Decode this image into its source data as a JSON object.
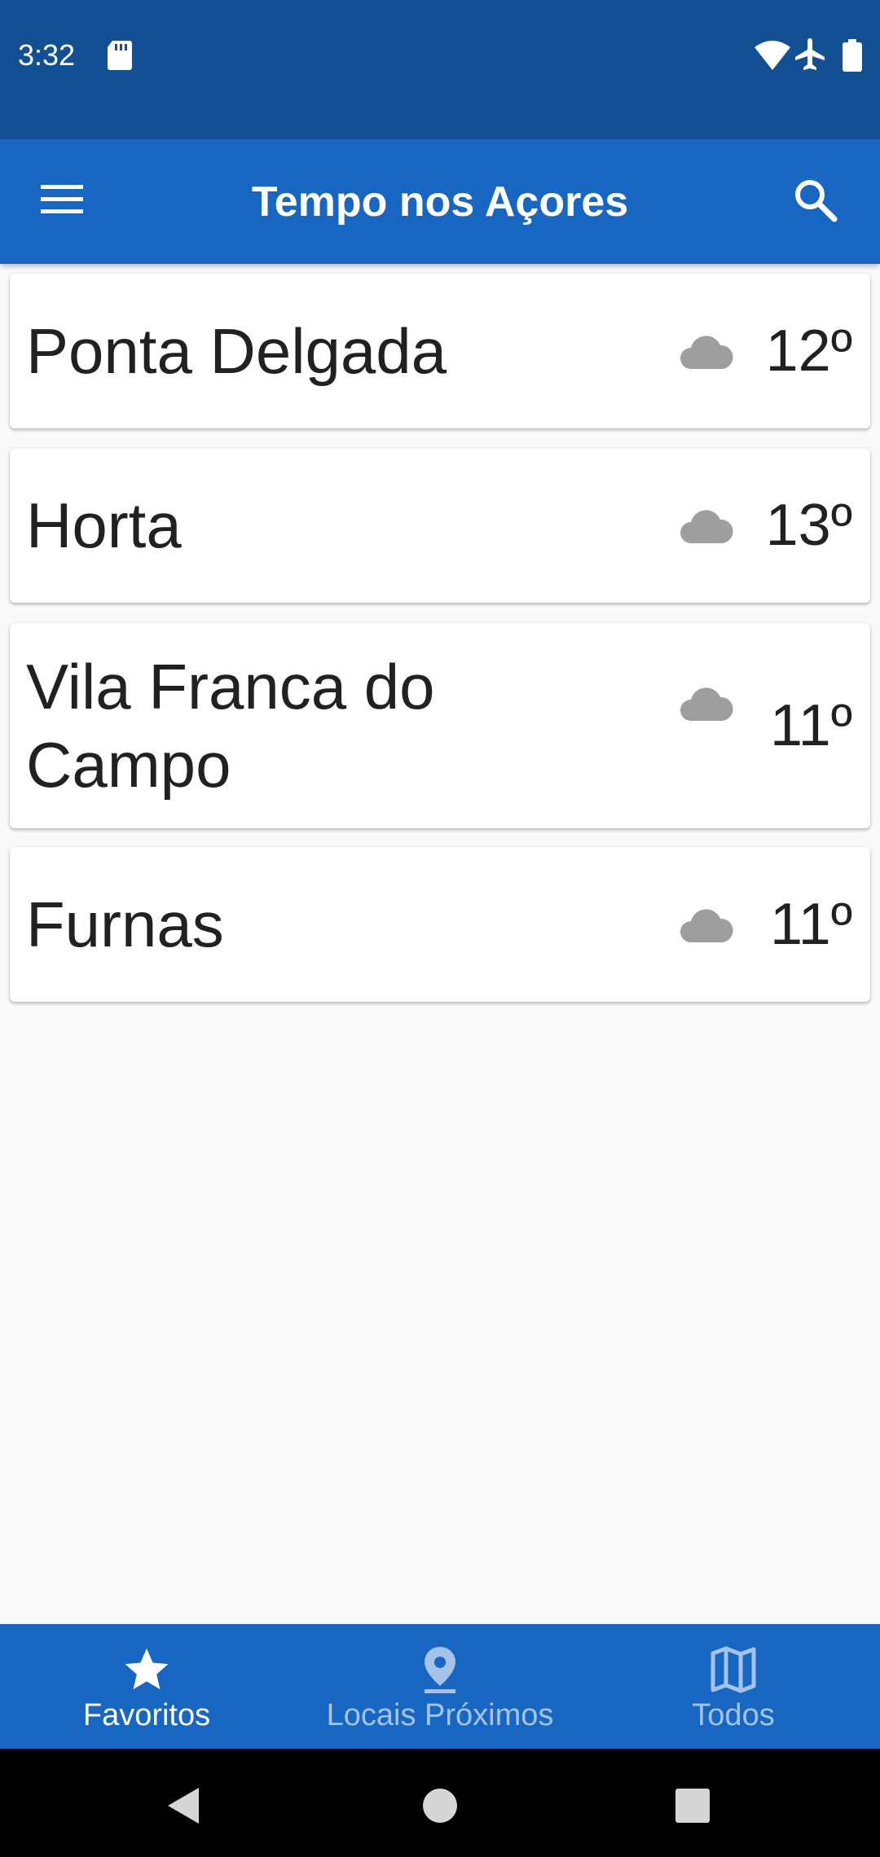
{
  "status_bar": {
    "time": "3:32",
    "icons": [
      "sd-card-icon",
      "wifi-icon",
      "airplane-mode-icon",
      "battery-icon"
    ]
  },
  "app_bar": {
    "title": "Tempo nos Açores",
    "menu_icon": "menu-icon",
    "search_icon": "search-icon"
  },
  "locations": [
    {
      "name": "Ponta Delgada",
      "weather_icon": "cloud-icon",
      "temperature": "12º"
    },
    {
      "name": "Horta",
      "weather_icon": "cloud-icon",
      "temperature": "13º"
    },
    {
      "name": "Vila Franca do Campo",
      "weather_icon": "cloud-icon",
      "temperature": "11º"
    },
    {
      "name": "Furnas",
      "weather_icon": "cloud-icon",
      "temperature": "11º"
    }
  ],
  "bottom_nav": {
    "items": [
      {
        "label": "Favoritos",
        "icon": "star-icon",
        "active": true
      },
      {
        "label": "Locais Próximos",
        "icon": "location-pin-icon",
        "active": false
      },
      {
        "label": "Todos",
        "icon": "map-icon",
        "active": false
      }
    ]
  },
  "system_nav": [
    "back-icon",
    "home-icon",
    "recents-icon"
  ],
  "colors": {
    "status_bar": "#124f93",
    "primary": "#1766c2",
    "background": "#fafafa",
    "inactive_tab": "#a4c2ea",
    "cloud": "#9e9e9e"
  }
}
